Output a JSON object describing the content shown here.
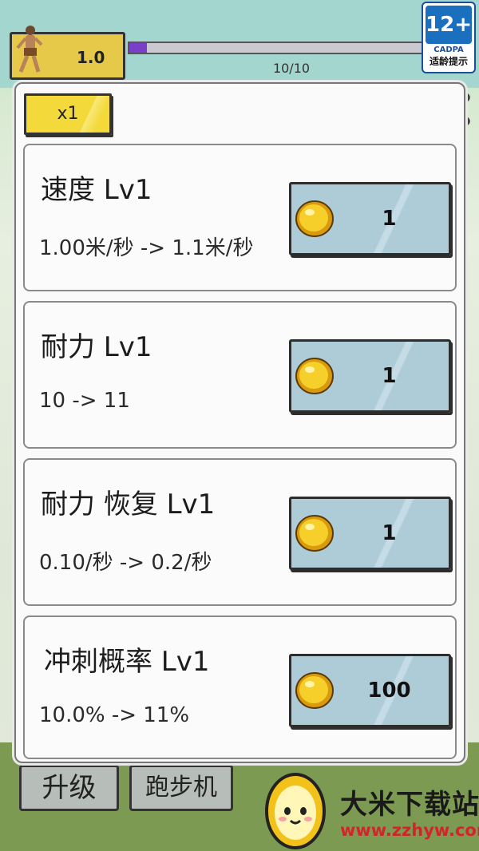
{
  "hud": {
    "level_value": "1.0",
    "progress_text": "10/10",
    "progress_fraction": 0.06
  },
  "age_badge": {
    "rating": "12+",
    "org": "CADPA",
    "label": "适龄提示"
  },
  "bottom_tabs": [
    {
      "label": "升级"
    },
    {
      "label": "跑步机"
    }
  ],
  "modal": {
    "multiplier_label": "x1",
    "upgrades": [
      {
        "title": "速度 Lv1",
        "detail": "1.00米/秒 -> 1.1米/秒",
        "price": "1"
      },
      {
        "title": "耐力 Lv1",
        "detail": "10 -> 11",
        "price": "1"
      },
      {
        "title": "耐力 恢复 Lv1",
        "detail": "0.10/秒 -> 0.2/秒",
        "price": "1"
      },
      {
        "title": "冲刺概率  Lv1",
        "detail": "10.0% -> 11%",
        "price": "100"
      }
    ]
  },
  "watermark": {
    "title": "大米下载站",
    "url": "www.zzhyw.com"
  },
  "colors": {
    "multiplier_yellow": "#f4d93a",
    "buy_button_blue": "#aecbd8",
    "progress_purple": "#7a3fc9",
    "coin_gold": "#f2c21b"
  },
  "icons": {
    "coin": "coin-icon",
    "close": "close-icon",
    "runner": "runner-icon"
  }
}
